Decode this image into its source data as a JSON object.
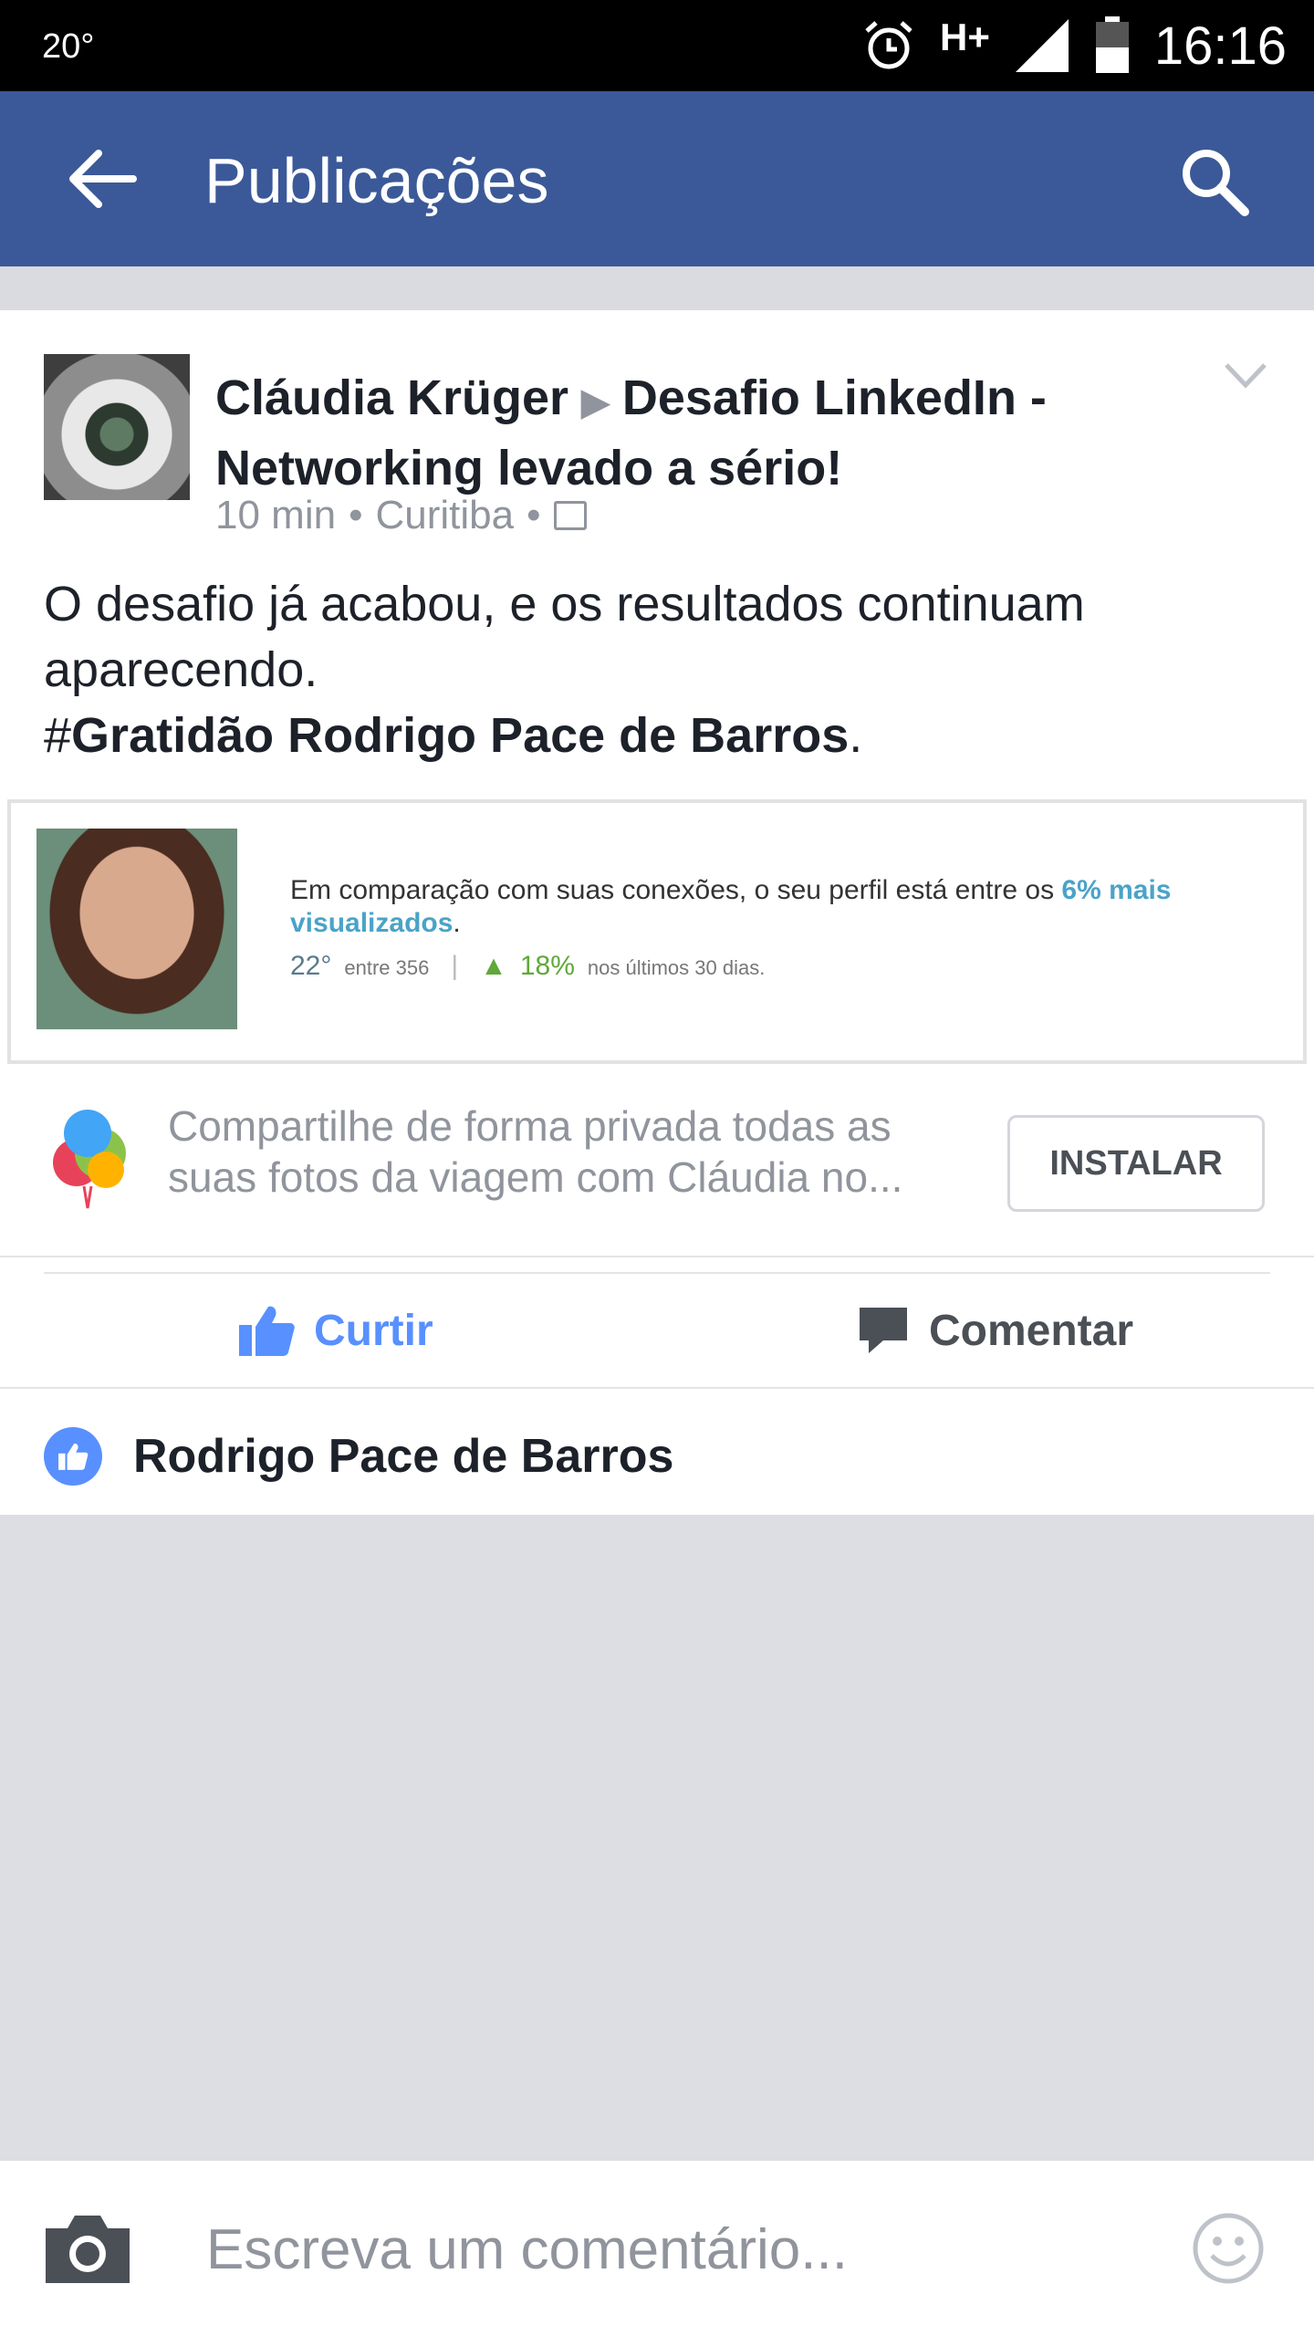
{
  "status_bar": {
    "temperature": "20°",
    "network": "H+",
    "time": "16:16"
  },
  "app_bar": {
    "title": "Publicações"
  },
  "post": {
    "author": "Cláudia Krüger",
    "group": "Desafio LinkedIn - Networking levado a sério!",
    "time_ago": "10 min",
    "location": "Curitiba",
    "text_line1": "O desafio já acabou, e os resultados continuam aparecendo.",
    "hashtag_prefix": "#",
    "hashtag": "Gratidão Rodrigo Pace de Barros",
    "hashtag_suffix": ".",
    "image": {
      "text_prefix": "Em comparação com suas conexões, o seu perfil está entre os ",
      "text_highlight": "6% mais visualizados",
      "text_suffix": ".",
      "rank": "22°",
      "rank_of": "entre 356",
      "growth": "18%",
      "growth_period": "nos últimos 30 dias."
    }
  },
  "promo": {
    "text": "Compartilhe de forma privada todas as suas fotos da viagem com Cláudia no...",
    "install_label": "INSTALAR"
  },
  "actions": {
    "like_label": "Curtir",
    "comment_label": "Comentar"
  },
  "likes": {
    "name": "Rodrigo Pace de Barros"
  },
  "composer": {
    "placeholder": "Escreva um comentário..."
  },
  "colors": {
    "brand": "#3b5998",
    "like_blue": "#5890ff",
    "highlight": "#4aa3c8",
    "growth_green": "#60a839"
  }
}
